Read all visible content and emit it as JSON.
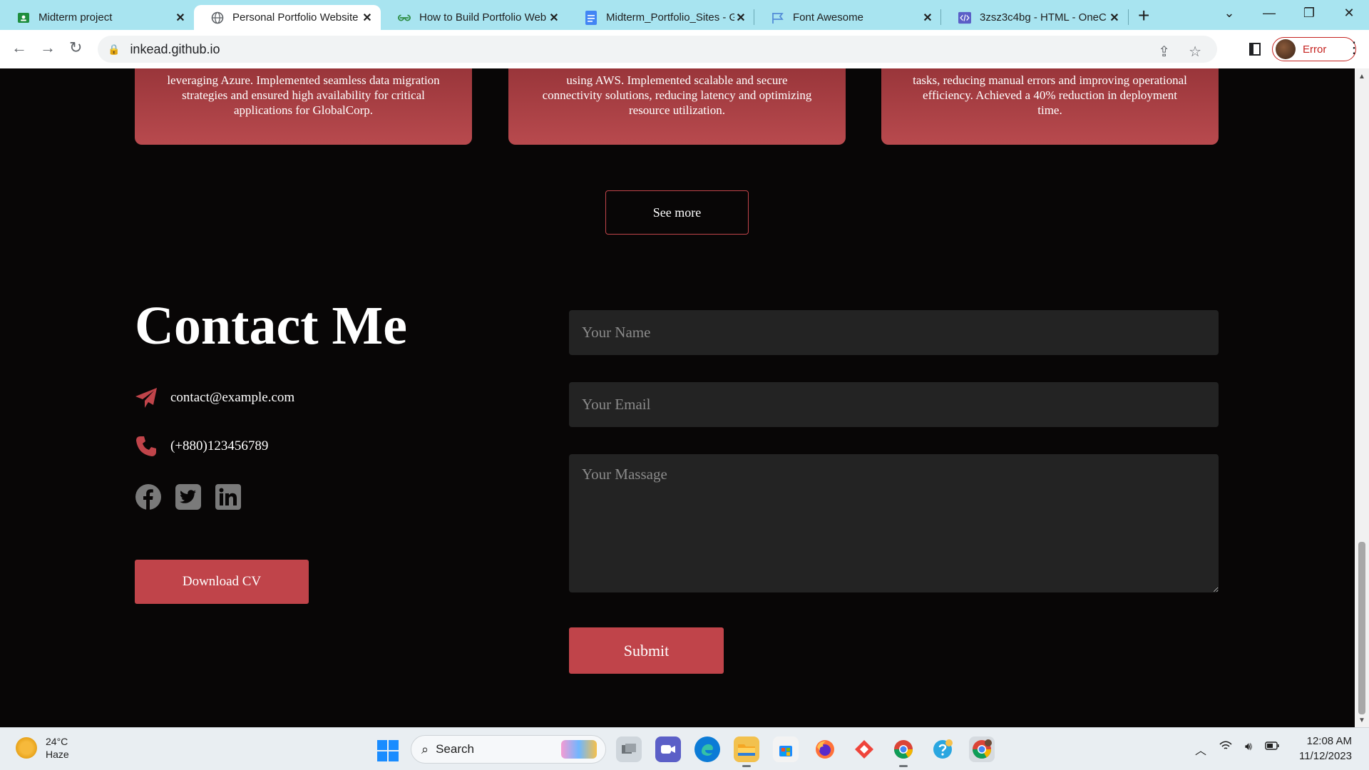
{
  "browser": {
    "tabs": [
      {
        "title": "Midterm project",
        "icon": "google-classroom-icon",
        "color": "#1e8e3e"
      },
      {
        "title": "Personal Portfolio Website",
        "icon": "globe-icon",
        "color": "#5f6368"
      },
      {
        "title": "How to Build Portfolio Web",
        "icon": "geeksforgeeks-icon",
        "color": "#2f8d46"
      },
      {
        "title": "Midterm_Portfolio_Sites - G",
        "icon": "google-docs-icon",
        "color": "#4285f4"
      },
      {
        "title": "Font Awesome",
        "icon": "flag-icon",
        "color": "#538dd7"
      },
      {
        "title": "3zsz3c4bg - HTML - OneC",
        "icon": "code-icon",
        "color": "#5b5fc7"
      }
    ],
    "new_tab": "+",
    "url": "inkead.github.io",
    "profile_status": "Error"
  },
  "experience_cards": [
    {
      "text": "leveraging Azure. Implemented seamless data migration strategies and ensured high availability for critical applications for GlobalCorp."
    },
    {
      "text": "using AWS. Implemented scalable and secure connectivity solutions, reducing latency and optimizing resource utilization."
    },
    {
      "text": "tasks, reducing manual errors and improving operational efficiency. Achieved a 40% reduction in deployment time."
    }
  ],
  "see_more_label": "See more",
  "contact": {
    "title": "Contact Me",
    "email": "contact@example.com",
    "phone": "(+880)123456789",
    "socials": [
      "facebook-icon",
      "twitter-icon",
      "linkedin-icon"
    ],
    "download_cv_label": "Download CV"
  },
  "form": {
    "name_placeholder": "Your Name",
    "email_placeholder": "Your Email",
    "message_placeholder": "Your Massage",
    "submit_label": "Submit"
  },
  "taskbar": {
    "temperature": "24°C",
    "condition": "Haze",
    "search_label": "Search",
    "time": "12:08 AM",
    "date": "11/12/2023"
  },
  "colors": {
    "accent": "#c0444a",
    "page_background": "#080606",
    "field_background": "#232323",
    "tab_strip": "#a8e4f0"
  }
}
